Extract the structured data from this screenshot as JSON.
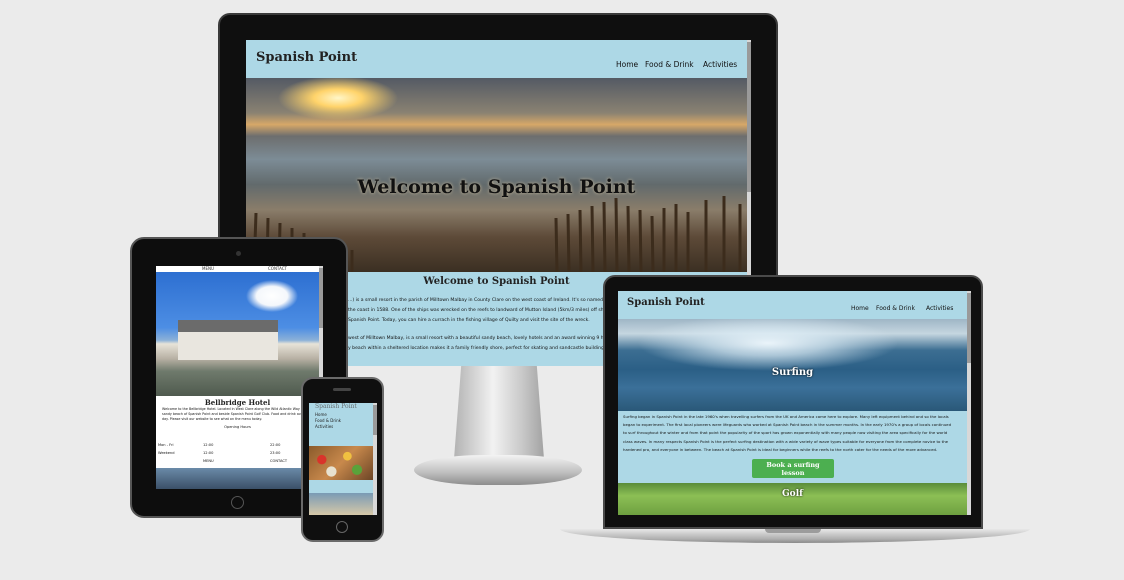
{
  "site_name": "Spanish Point",
  "nav": [
    "Home",
    "Food & Drink",
    "Activities"
  ],
  "desktop": {
    "hero_text": "Welcome to Spanish Point",
    "section_title": "Welcome to Spanish Point",
    "paragraph_1_lines": [
      "...) is a small resort in the parish of Milltown Malbay in County Clare on the west coast of Ireland. It's so named",
      "the coast in 1588. One of the ships was wrecked on the reefs to landward of Mutton Island (5km/3 miles) off sh",
      "Spanish Point. Today, you can hire a currach in the fishing village of Quilty and visit the site of the wreck."
    ],
    "paragraph_2_lines": [
      "west of Milltown Malbay, is a small resort with a beautiful sandy beach, lovely hotels and an award winning 9 h",
      "y beach within a sheltered location makes it a family friendly shore, perfect for skating and sandcastle building"
    ]
  },
  "tablet": {
    "top_links": [
      "MENU",
      "CONTACT"
    ],
    "hotel_title": "Bellbridge Hotel",
    "hotel_text_lines": [
      "Welcome to the Bellbridge Hotel. Located in West Clare along the Wild Atlantic Way by",
      "sandy beach of Spanish Point and beside Spanish Point Golf Club. Food and drink avail",
      "day. Please visit our website to see what on the menu today."
    ],
    "hours_title": "Opening Hours",
    "hours_rows": [
      [
        "Mon - Fri",
        "12:00",
        "22:00"
      ],
      [
        "Weekend",
        "12:00",
        "23:00"
      ],
      [
        "",
        "MENU",
        "CONTACT"
      ]
    ]
  },
  "phone": {
    "nav_links": [
      "Home",
      "Food & Drink",
      "Activities"
    ]
  },
  "laptop": {
    "surfing_label": "Surfing",
    "surf_text_lines": [
      "Surfing began in Spanish Point in the late 1960's when travelling surfers from the UK and America came here to explore. Many left equipment behind and so the locals",
      "began to experiment. The first local pioneers were lifeguards who worked at Spanish Point beach in the summer months. In the early 1970's a group of locals continued",
      "to surf throughout the winter and from that point the popularity of the sport has grown exponentially with many people now visiting the area specifically for the world",
      "class waves. In many respects Spanish Point is the perfect surfing destination with a wide variety of wave types suitable for everyone from the complete novice to the",
      "hardened pro, and everyone in between. The beach at Spanish Point is ideal for beginners while the reefs to the north cater for the needs of the more advanced."
    ],
    "cta_label": "Book a surfing lesson",
    "golf_label": "Golf"
  }
}
